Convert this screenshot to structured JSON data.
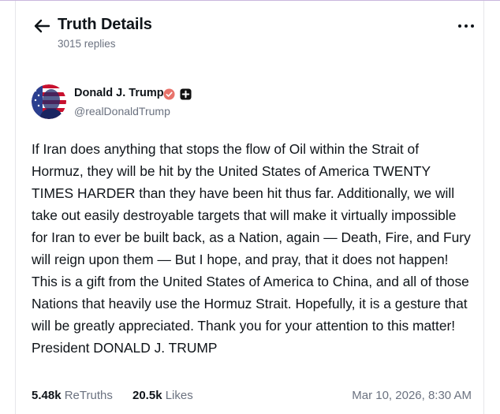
{
  "header": {
    "title": "Truth Details",
    "replies": "3015 replies"
  },
  "post": {
    "author": {
      "name": "Donald J. Trump",
      "handle": "@realDonaldTrump",
      "verified_color": "#e8736b"
    },
    "text": "If Iran does anything that stops the flow of Oil within the Strait of Hormuz, they will be hit by the United States of America TWENTY TIMES HARDER than they have been hit thus far. Additionally, we will take out easily destroyable targets that will make it virtually impossible for Iran to ever be built back, as a Nation, again — Death, Fire, and Fury will reign upon them — But I hope, and pray, that it does not happen! This is a gift from the United States of America to China, and all of those Nations that heavily use the Hormuz Strait. Hopefully, it is a gesture that will be greatly appreciated. Thank you for your attention to this matter! President DONALD J. TRUMP",
    "retruths_count": "5.48k",
    "retruths_label": "ReTruths",
    "likes_count": "20.5k",
    "likes_label": "Likes",
    "timestamp": "Mar 10, 2026, 8:30 AM"
  },
  "icons": {
    "back": "arrow-left-icon",
    "more": "more-horizontal-icon",
    "verified": "verified-badge-icon",
    "plus": "plus-badge-icon"
  }
}
